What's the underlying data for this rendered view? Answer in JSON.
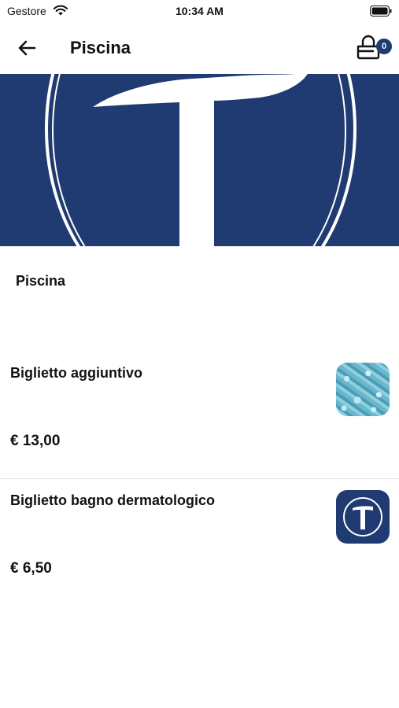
{
  "status_bar": {
    "carrier": "Gestore",
    "time": "10:34 AM"
  },
  "nav": {
    "title": "Piscina",
    "cart_count": "0"
  },
  "section": {
    "title": "Piscina"
  },
  "products": [
    {
      "name": "Biglietto aggiuntivo",
      "price": "€ 13,00",
      "thumbnail": "pool-water-image"
    },
    {
      "name": "Biglietto bagno dermatologico",
      "price": "€ 6,50",
      "thumbnail": "t-logo-image"
    }
  ],
  "colors": {
    "brand": "#1f3b71",
    "badge": "#1c3c72",
    "divider": "#e2e2e2"
  }
}
